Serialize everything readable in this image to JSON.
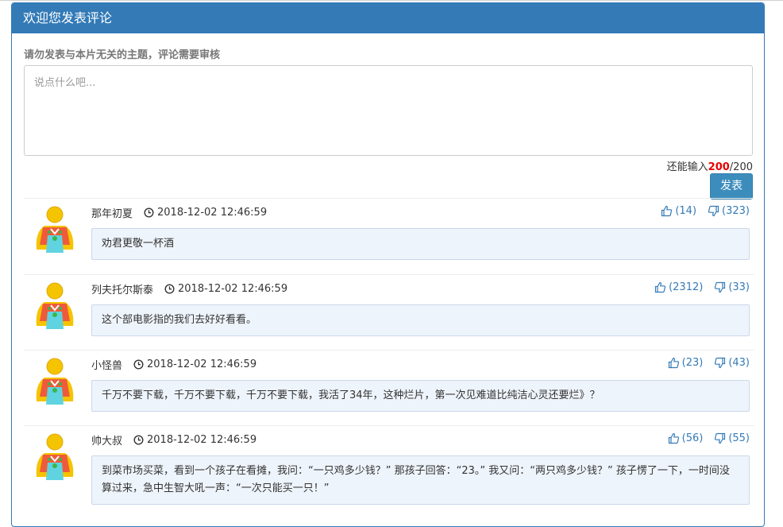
{
  "header": {
    "title": "欢迎您发表评论"
  },
  "form": {
    "notice": "请勿发表与本片无关的主题，评论需要审核",
    "placeholder": "说点什么吧...",
    "counter_prefix": "还能输入",
    "counter_remaining": "200",
    "counter_suffix": "/200",
    "submit_label": "发表"
  },
  "colors": {
    "accent": "#337ab7",
    "counter": "#e60000",
    "comment_bg": "#eef4fb"
  },
  "comments": [
    {
      "user": "那年初夏",
      "time": "2018-12-02 12:46:59",
      "likes": "(14)",
      "dislikes": "(323)",
      "text": "劝君更敬一杯酒"
    },
    {
      "user": "列夫托尔斯泰",
      "time": "2018-12-02 12:46:59",
      "likes": "(2312)",
      "dislikes": "(33)",
      "text": "这个部电影指的我们去好好看看。"
    },
    {
      "user": "小怪兽",
      "time": "2018-12-02 12:46:59",
      "likes": "(23)",
      "dislikes": "(43)",
      "text": "千万不要下载，千万不要下载，千万不要下载，我活了34年，这种烂片，第一次见难道比纯洁心灵还要烂》？"
    },
    {
      "user": "帅大叔",
      "time": "2018-12-02 12:46:59",
      "likes": "(56)",
      "dislikes": "(55)",
      "text": "到菜市场买菜，看到一个孩子在看摊，我问：“一只鸡多少钱？” 那孩子回答：“23。” 我又问：“两只鸡多少钱？” 孩子愣了一下，一时间没算过来，急中生智大吼一声：“一次只能买一只！”"
    }
  ]
}
